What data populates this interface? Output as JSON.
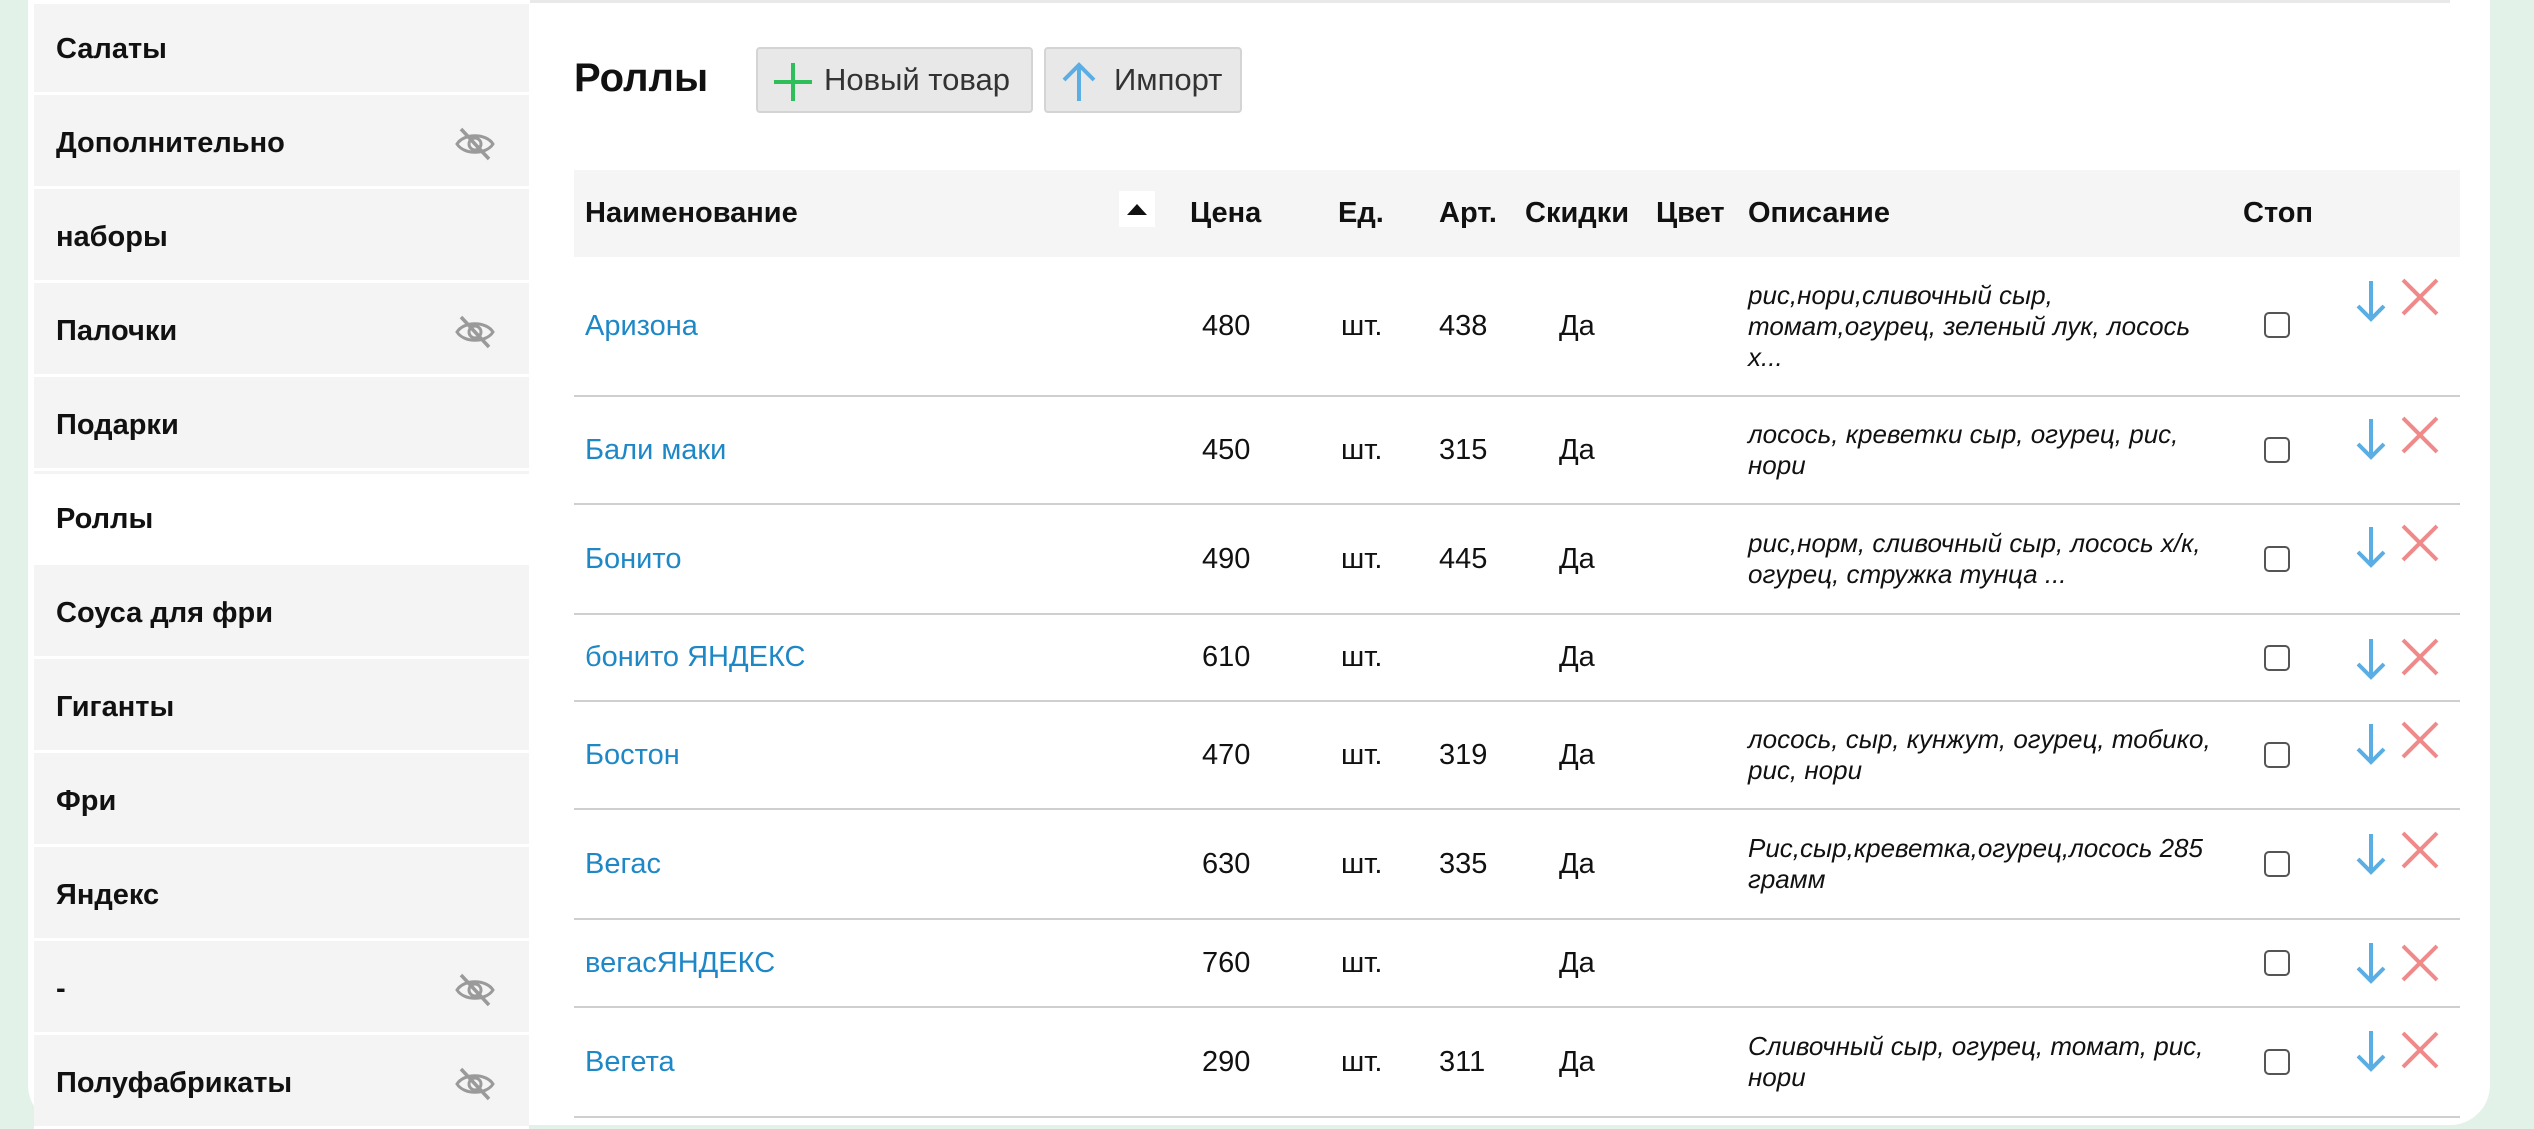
{
  "sidebar": {
    "items": [
      {
        "label": "Салаты",
        "hidden": false,
        "active": false
      },
      {
        "label": "Дополнительно",
        "hidden": true,
        "active": false
      },
      {
        "label": "наборы",
        "hidden": false,
        "active": false
      },
      {
        "label": "Палочки",
        "hidden": true,
        "active": false
      },
      {
        "label": "Подарки",
        "hidden": false,
        "active": false
      },
      {
        "label": "Роллы",
        "hidden": false,
        "active": true
      },
      {
        "label": "Соуса для фри",
        "hidden": false,
        "active": false
      },
      {
        "label": "Гиганты",
        "hidden": false,
        "active": false
      },
      {
        "label": "Фри",
        "hidden": false,
        "active": false
      },
      {
        "label": "Яндекс",
        "hidden": false,
        "active": false
      },
      {
        "label": "-",
        "hidden": true,
        "active": false
      },
      {
        "label": "Полуфабрикаты",
        "hidden": true,
        "active": false
      }
    ]
  },
  "header": {
    "title": "Роллы",
    "new_item_label": "Новый товар",
    "import_label": "Импорт"
  },
  "table": {
    "columns": {
      "name": "Наименование",
      "price": "Цена",
      "unit": "Ед.",
      "sku": "Арт.",
      "discounts": "Скидки",
      "color": "Цвет",
      "description": "Описание",
      "stop": "Стоп"
    },
    "sort": {
      "column": "name",
      "direction": "ascending"
    },
    "rows": [
      {
        "name": "Аризона",
        "price": "480",
        "unit": "шт.",
        "sku": "438",
        "discounts": "Да",
        "color": "",
        "description": "рис,нори,сливочный сыр, томат,огурец, зеленый лук, лосось х...",
        "stop": false
      },
      {
        "name": "Бали маки",
        "price": "450",
        "unit": "шт.",
        "sku": "315",
        "discounts": "Да",
        "color": "",
        "description": "лосось, креветки сыр, огурец, рис, нори",
        "stop": false
      },
      {
        "name": "Бонито",
        "price": "490",
        "unit": "шт.",
        "sku": "445",
        "discounts": "Да",
        "color": "",
        "description": "рис,норм, сливочный сыр, лосось х/к, огурец, стружка тунца ...",
        "stop": false
      },
      {
        "name": "бонито ЯНДЕКС",
        "price": "610",
        "unit": "шт.",
        "sku": "",
        "discounts": "Да",
        "color": "",
        "description": "",
        "stop": false
      },
      {
        "name": "Бостон",
        "price": "470",
        "unit": "шт.",
        "sku": "319",
        "discounts": "Да",
        "color": "",
        "description": "лосось, сыр, кунжут, огурец, тобико, рис, нори",
        "stop": false
      },
      {
        "name": "Вегас",
        "price": "630",
        "unit": "шт.",
        "sku": "335",
        "discounts": "Да",
        "color": "",
        "description": "Рис,сыр,креветка,огурец,лосось 285 грамм",
        "stop": false
      },
      {
        "name": "вегасЯНДЕКС",
        "price": "760",
        "unit": "шт.",
        "sku": "",
        "discounts": "Да",
        "color": "",
        "description": "",
        "stop": false
      },
      {
        "name": "Вегета",
        "price": "290",
        "unit": "шт.",
        "sku": "311",
        "discounts": "Да",
        "color": "",
        "description": "Сливочный сыр, огурец, томат, рис, нори",
        "stop": false
      }
    ]
  },
  "colors": {
    "link": "#1e88c7",
    "plus_icon": "#2fbf5a",
    "arrow_icon": "#5aaee3",
    "delete_icon": "#f08a8a",
    "sidebar_bg": "#f4f4f4",
    "frame_bg": "#e3f2e8"
  }
}
